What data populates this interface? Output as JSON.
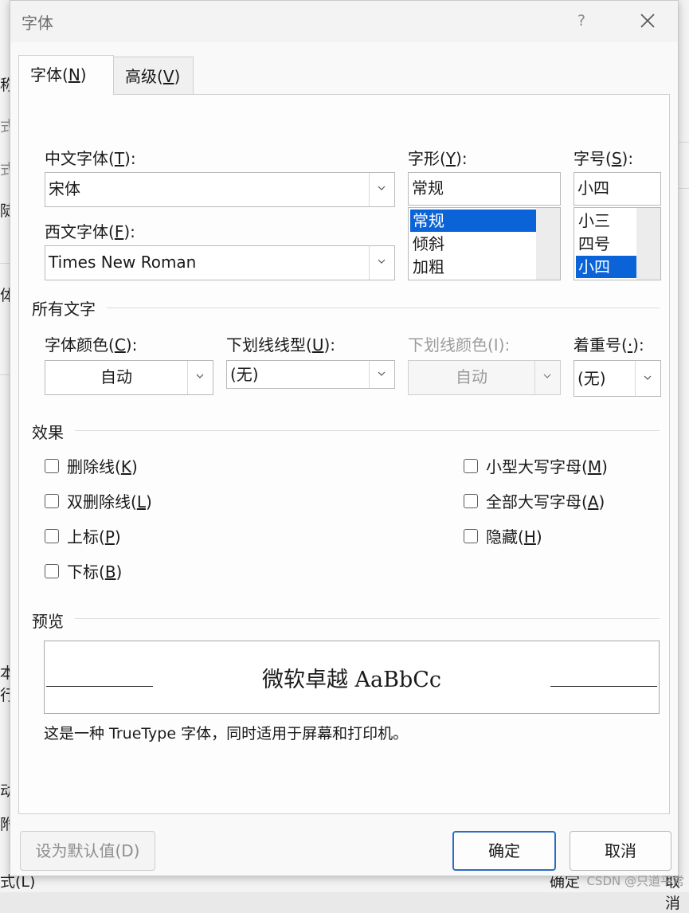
{
  "background": {
    "fragments": [
      "称",
      "式",
      "式",
      "陡",
      "体",
      "本",
      "行",
      "动",
      "附",
      "式(L)",
      "确定",
      "取消"
    ]
  },
  "dialog": {
    "title": "字体",
    "help_icon": "?",
    "close_icon": "close-icon",
    "tabs": [
      {
        "label": "字体(",
        "key": "N",
        "suffix": ")",
        "active": true
      },
      {
        "label": "高级(",
        "key": "V",
        "suffix": ")",
        "active": false
      }
    ],
    "chinese_font": {
      "label_pre": "中文字体(",
      "key": "T",
      "label_post": "):",
      "value": "宋体"
    },
    "western_font": {
      "label_pre": "西文字体(",
      "key": "F",
      "label_post": "):",
      "value": "Times New Roman"
    },
    "font_style": {
      "label_pre": "字形(",
      "key": "Y",
      "label_post": "):",
      "value": "常规",
      "options": [
        {
          "text": "常规",
          "selected": true
        },
        {
          "text": "倾斜",
          "selected": false
        },
        {
          "text": "加粗",
          "selected": false
        }
      ]
    },
    "font_size": {
      "label_pre": "字号(",
      "key": "S",
      "label_post": "):",
      "value": "小四",
      "options": [
        {
          "text": "小三",
          "selected": false
        },
        {
          "text": "四号",
          "selected": false
        },
        {
          "text": "小四",
          "selected": true
        }
      ]
    },
    "all_text": {
      "section": "所有文字",
      "font_color": {
        "label_pre": "字体颜色(",
        "key": "C",
        "label_post": "):",
        "value": "自动"
      },
      "underline_style": {
        "label_pre": "下划线线型(",
        "key": "U",
        "label_post": "):",
        "value": "(无)"
      },
      "underline_color": {
        "label": "下划线颜色(I):",
        "value": "自动",
        "disabled": true
      },
      "emphasis": {
        "label_pre": "着重号(",
        "key": "·",
        "label_post": "):",
        "value": "(无)"
      }
    },
    "effects": {
      "section": "效果",
      "left": [
        {
          "pre": "删除线(",
          "key": "K",
          "post": ")",
          "checked": false
        },
        {
          "pre": "双删除线(",
          "key": "L",
          "post": ")",
          "checked": false
        },
        {
          "pre": "上标(",
          "key": "P",
          "post": ")",
          "checked": false
        },
        {
          "pre": "下标(",
          "key": "B",
          "post": ")",
          "checked": false
        }
      ],
      "right": [
        {
          "pre": "小型大写字母(",
          "key": "M",
          "post": ")",
          "checked": false
        },
        {
          "pre": "全部大写字母(",
          "key": "A",
          "post": ")",
          "checked": false
        },
        {
          "pre": "隐藏(",
          "key": "H",
          "post": ")",
          "checked": false
        }
      ]
    },
    "preview": {
      "section": "预览",
      "sample": "微软卓越 AaBbCc",
      "description": "这是一种 TrueType 字体，同时适用于屏幕和打印机。"
    },
    "buttons": {
      "set_default": "设为默认值(D)",
      "ok": "确定",
      "cancel": "取消"
    }
  },
  "watermark": "CSDN @只道平常"
}
